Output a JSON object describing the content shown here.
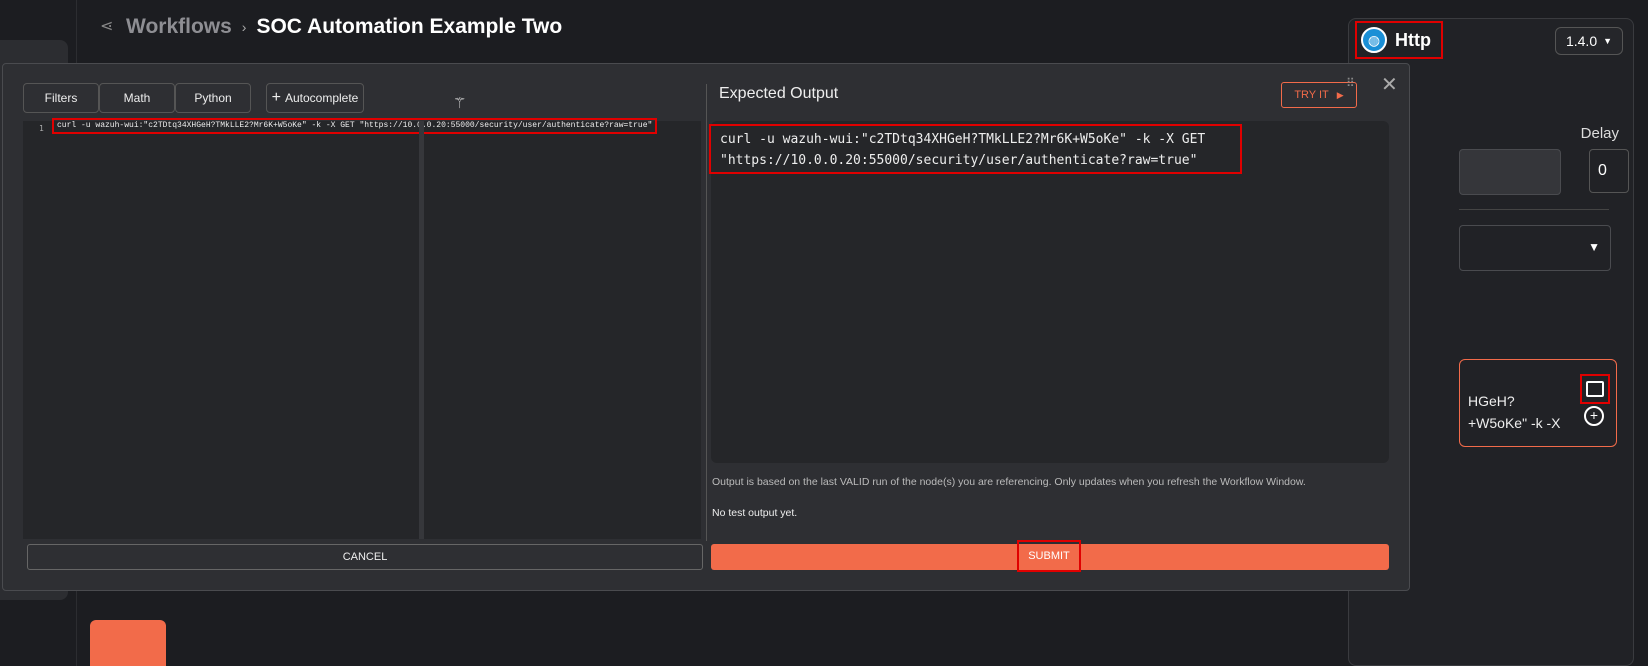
{
  "header": {
    "breadcrumb_link": "Workflows",
    "breadcrumb_sep": "›",
    "title": "SOC Automation Example Two"
  },
  "side_panel": {
    "app_name": "Http",
    "version": "1.4.0",
    "delay_label": "Delay",
    "delay_value": "0",
    "body_preview": "HGeH?\n+W5oKe\" -k -X"
  },
  "modal": {
    "tabs": [
      "Filters",
      "Math",
      "Python"
    ],
    "autocomplete_label": "Autocomplete",
    "editor": {
      "line_number": "1",
      "code": "curl -u wazuh-wui:\"c2TDtq34XHGeH?TMkLLE2?Mr6K+W5oKe\" -k -X GET \"https://10.0.0.20:55000/security/user/authenticate?raw=true\""
    },
    "output": {
      "title": "Expected Output",
      "try_label": "TRY IT",
      "code": "curl -u wazuh-wui:\"c2TDtq34XHGeH?TMkLLE2?Mr6K+W5oKe\" -k -X GET\n\"https://10.0.0.20:55000/security/user/authenticate?raw=true\"",
      "note": "Output is based on the last VALID run of the node(s) you are referencing. Only updates when you refresh the Workflow Window.",
      "empty_text": "No test output yet."
    },
    "cancel_label": "CANCEL",
    "submit_label": "SUBMIT"
  },
  "colors": {
    "accent": "#f26b4a",
    "highlight": "#e00000",
    "background": "#1c1d21"
  },
  "icons": [
    "workflow-icon",
    "globe-icon",
    "chevron-down-icon",
    "plus-icon",
    "magic-wand-icon",
    "play-icon",
    "drag-handle-icon",
    "close-icon",
    "expand-icon",
    "add-circle-icon"
  ]
}
